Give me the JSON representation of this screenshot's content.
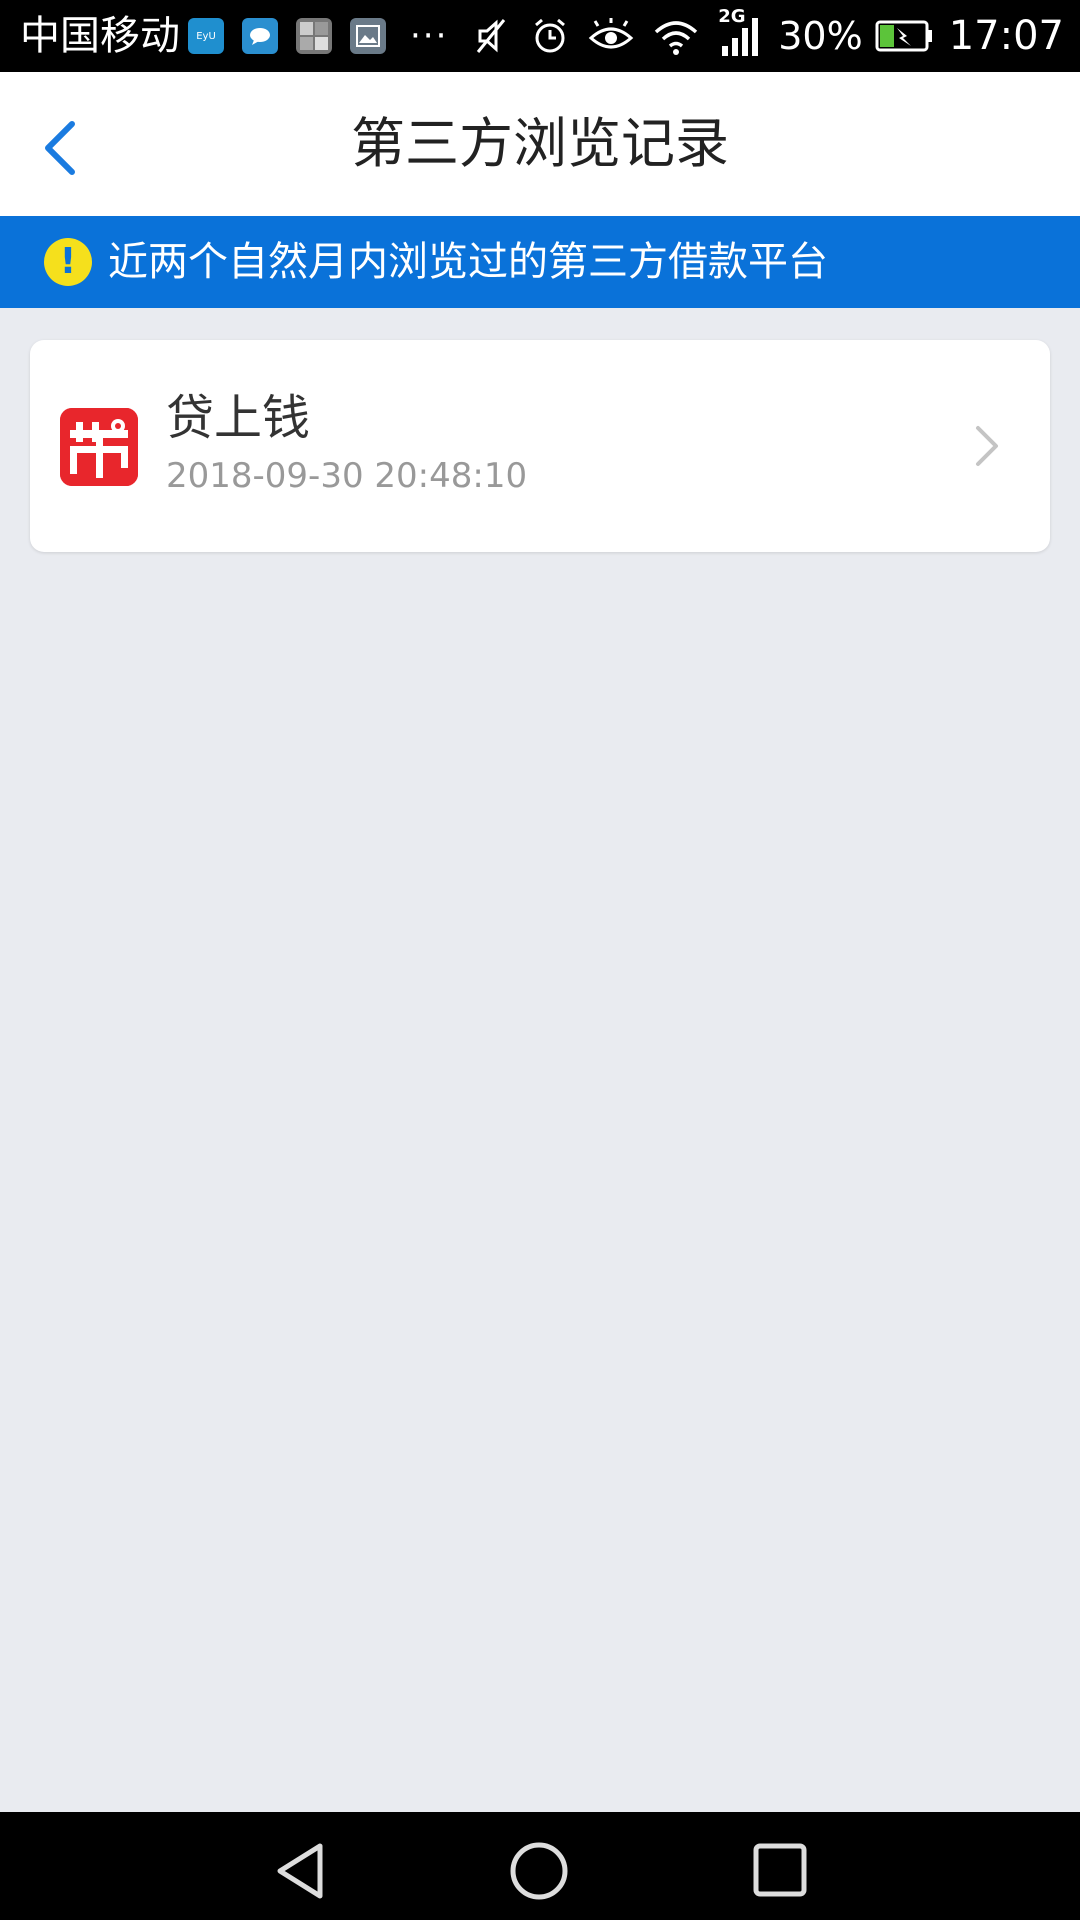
{
  "status_bar": {
    "carrier": "中国移动",
    "network_type": "2G",
    "battery_percent": "30%",
    "time": "17:07"
  },
  "header": {
    "title": "第三方浏览记录"
  },
  "notice": {
    "text": "近两个自然月内浏览过的第三方借款平台"
  },
  "history": {
    "items": [
      {
        "name": "贷上钱",
        "time": "2018-09-30 20:48:10",
        "logo_color": "#e8262c"
      }
    ]
  },
  "colors": {
    "accent": "#0a72d9",
    "background": "#e9ebf0",
    "notice_icon": "#f5e01c"
  }
}
